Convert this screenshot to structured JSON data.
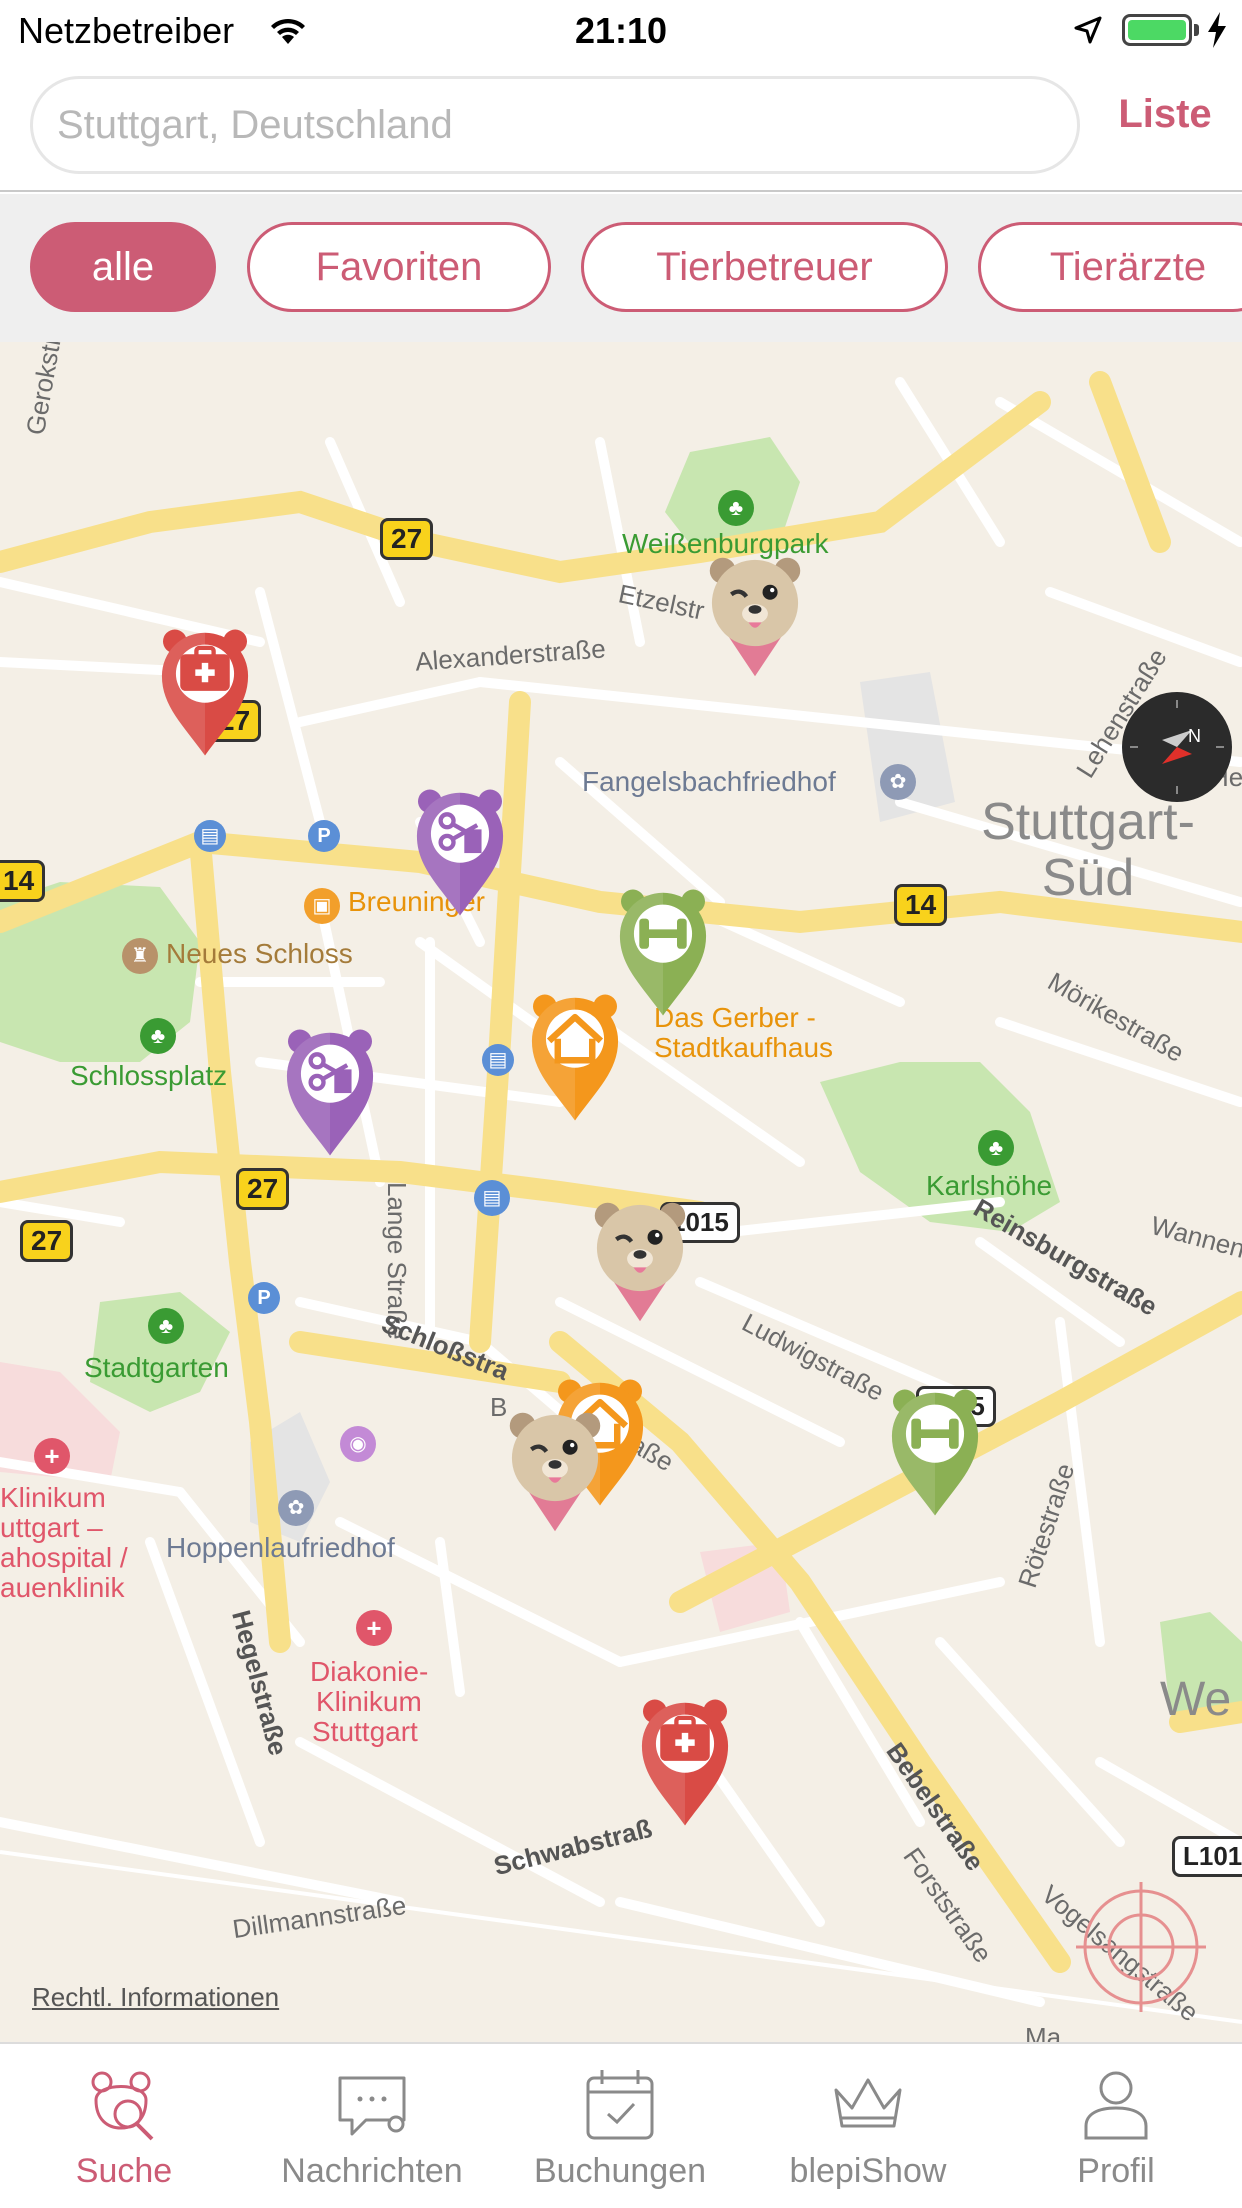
{
  "status_bar": {
    "carrier": "Netzbetreiber",
    "time": "21:10",
    "battery_level": 1.0,
    "battery_color": "#4cd964"
  },
  "search": {
    "placeholder": "Stuttgart, Deutschland",
    "value": "",
    "list_label": "Liste"
  },
  "filters": {
    "chips": [
      {
        "label": "alle",
        "active": true
      },
      {
        "label": "Favoriten",
        "active": false
      },
      {
        "label": "Tierbetreuer",
        "active": false
      },
      {
        "label": "Tierärzte",
        "active": false
      }
    ]
  },
  "map": {
    "streets": {
      "gerokstrasse": "Gerokstraße",
      "alexanderstrasse": "Alexanderstraße",
      "etzelstrasse": "Etzelstr",
      "lehenstrasse": "Lehenstraße",
      "moerikestrasse": "Mörikestraße",
      "reinsburgstrasse": "Reinsburgstraße",
      "wannen": "Wannen",
      "lange_strasse": "Lange Straße",
      "schlossstrasse": "Schloßstra",
      "ludwigstrasse": "Ludwigstraße",
      "roetestrasse": "Rötestraße",
      "hegelstrasse": "Hegelstraße",
      "bebelstrasse": "Bebelstraße",
      "forststrasse": "Forststraße",
      "schwabstrasse": "Schwabstraß",
      "vogelsangstrasse": "Vogelsangstraße",
      "dillmannstrasse": "Dillmannstraße",
      "feldstrasse": "eldstraße",
      "b_fragment": "B",
      "he_fragment": "He",
      "ma_fragment": "Ma",
      "we_fragment": "We"
    },
    "parks": {
      "weissenburgpark": "Weißenburgpark",
      "schlossplatz": "Schlossplatz",
      "karlshoehe": "Karlshöhe",
      "stadtgarten": "Stadtgarten"
    },
    "pois": {
      "fangelsbachfriedhof": "Fangelsbachfriedhof",
      "hoppenlaufriedhof": "Hoppenlaufriedhof",
      "breuninger": "Breuninger",
      "neues_schloss": "Neues Schloss",
      "das_gerber_1": "Das Gerber -",
      "das_gerber_2": "Stadtkaufhaus",
      "klinikum_1": "Klinikum",
      "klinikum_2": "uttgart –",
      "klinikum_3": "ahospital /",
      "klinikum_4": "auenklinik",
      "diakonie_1": "Diakonie-",
      "diakonie_2": "Klinikum",
      "diakonie_3": "Stuttgart"
    },
    "district": {
      "line1": "Stuttgart-",
      "line2": "Süd"
    },
    "shields": {
      "s27_a": "27",
      "s27_b": "27",
      "s27_c": "27",
      "s27_d": "27",
      "s14_a": "14",
      "s14_b": "14",
      "l1015_a": "1015",
      "l1015_b": "1015",
      "l101": "L101"
    },
    "legal": "Rechtl. Informationen",
    "pins": [
      {
        "type": "tierarzt",
        "icon": "first-aid-icon",
        "color": "#d94b45"
      },
      {
        "type": "mascot",
        "icon": "bear-face-icon",
        "color": "#e27b95"
      },
      {
        "type": "groomer",
        "icon": "scissors-comb-icon",
        "color": "#9a62b8"
      },
      {
        "type": "training",
        "icon": "dumbbell-icon",
        "color": "#8bb054"
      },
      {
        "type": "home-care",
        "icon": "house-icon",
        "color": "#f4971c"
      },
      {
        "type": "groomer",
        "icon": "scissors-comb-icon",
        "color": "#9a62b8"
      },
      {
        "type": "mascot",
        "icon": "bear-face-icon",
        "color": "#e27b95"
      },
      {
        "type": "training",
        "icon": "dumbbell-icon",
        "color": "#8bb054"
      },
      {
        "type": "home-care",
        "icon": "house-icon",
        "color": "#f4971c"
      },
      {
        "type": "mascot",
        "icon": "bear-face-icon",
        "color": "#e27b95"
      },
      {
        "type": "tierarzt",
        "icon": "first-aid-icon",
        "color": "#d94b45"
      }
    ]
  },
  "tabs": [
    {
      "label": "Suche",
      "icon": "bear-search-icon",
      "active": true
    },
    {
      "label": "Nachrichten",
      "icon": "chat-bubble-icon",
      "active": false
    },
    {
      "label": "Buchungen",
      "icon": "calendar-check-icon",
      "active": false
    },
    {
      "label": "blepiShow",
      "icon": "crown-icon",
      "active": false
    },
    {
      "label": "Profil",
      "icon": "person-icon",
      "active": false
    }
  ],
  "colors": {
    "accent": "#cc5c75",
    "map_background": "#f4efe6",
    "park_green": "#c8e6b0",
    "road_yellow": "#f8e08a"
  }
}
